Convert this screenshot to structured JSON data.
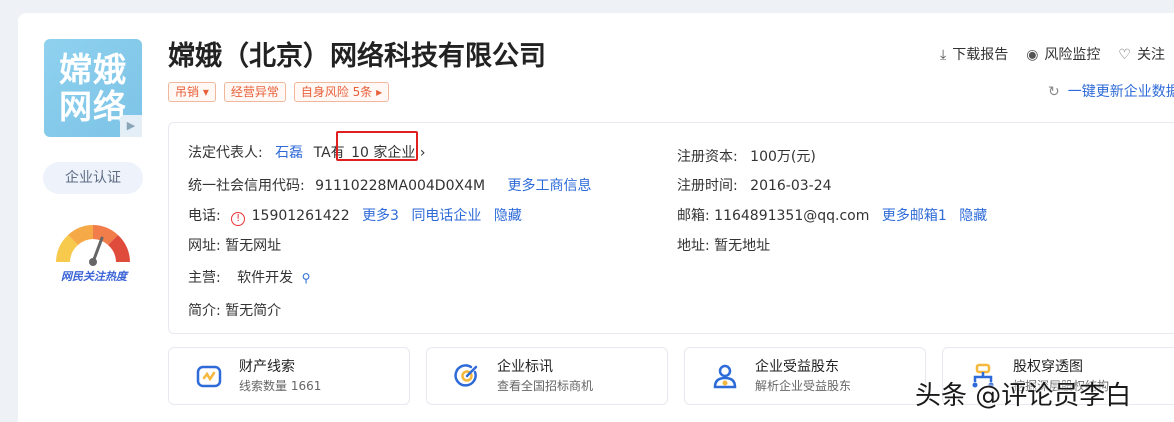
{
  "company": {
    "logo_line1": "嫦娥",
    "logo_line2": "网络",
    "name": "嫦娥（北京）网络科技有限公司",
    "certification": "企业认证",
    "heat_caption": "网民关注热度"
  },
  "tags": [
    "吊销 ▾",
    "经营异常",
    "自身风险 5条 ▸"
  ],
  "actions": {
    "download": "下载报告",
    "monitor": "风险监控",
    "follow": "关注",
    "update": "一键更新企业数据"
  },
  "info": {
    "legal_rep_label": "法定代表人:",
    "legal_rep_name": "石磊",
    "ta_prefix": "TA有",
    "ta_companies": "10 家企业 ›",
    "credit_label": "统一社会信用代码:",
    "credit_code": "91110228MA004D0X4M",
    "credit_more": "更多工商信息",
    "phone_label": "电话:",
    "phone_alert": "!",
    "phone": "15901261422",
    "phone_more": "更多3",
    "phone_same": "同电话企业",
    "phone_hide": "隐藏",
    "website_label": "网址:",
    "website": "暂无网址",
    "business_label": "主营:",
    "business": "软件开发",
    "intro_label": "简介:",
    "intro": "暂无简介",
    "capital_label": "注册资本:",
    "capital": "100万(元)",
    "reg_date_label": "注册时间:",
    "reg_date": "2016-03-24",
    "email_label": "邮箱:",
    "email": "1164891351@qq.com",
    "email_more": "更多邮箱1",
    "email_hide": "隐藏",
    "address_label": "地址:",
    "address": "暂无地址"
  },
  "cards": [
    {
      "title": "财产线索",
      "sub": "线索数量 1661"
    },
    {
      "title": "企业标讯",
      "sub": "查看全国招标商机"
    },
    {
      "title": "企业受益股东",
      "sub": "解析企业受益股东"
    },
    {
      "title": "股权穿透图",
      "sub": "挖掘深层股权结构"
    }
  ],
  "watermark": "头条 @评论员李白",
  "colors": {
    "link": "#2f6bd8",
    "tag": "#e8603a",
    "highlight_box": "#e02020"
  }
}
